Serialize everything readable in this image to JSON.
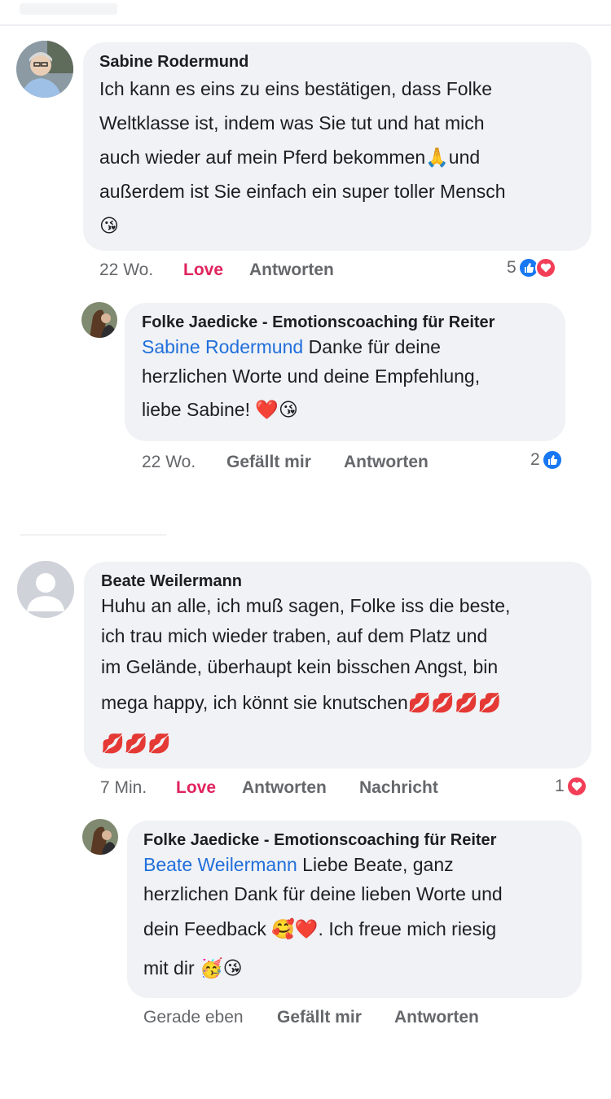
{
  "comments": [
    {
      "author": "Sabine Rodermund",
      "lines": [
        "Ich kann es eins zu eins bestätigen, dass Folke",
        "Weltklasse ist, indem was Sie tut und hat mich",
        "auch wieder auf mein Pferd bekommen🙏und",
        "außerdem ist Sie einfach ein super toller Mensch",
        "😘"
      ],
      "time": "22 Wo.",
      "action1": "Love",
      "reply": "Antworten",
      "reaction_count": "5"
    },
    {
      "author": "Folke Jaedicke - Emotionscoaching für Reiter",
      "mention": "Sabine Rodermund",
      "line1_rest": " Danke für deine",
      "line2": "herzlichen Worte und deine Empfehlung,",
      "line3": "liebe Sabine! ❤️😘",
      "time": "22 Wo.",
      "action1": "Gefällt mir",
      "reply": "Antworten",
      "reaction_count": "2"
    },
    {
      "author": "Beate Weilermann",
      "lines": [
        "Huhu an alle, ich muß sagen, Folke iss die beste,",
        "ich trau mich wieder traben, auf dem Platz und",
        "im Gelände, überhaupt kein bisschen Angst, bin",
        "mega happy, ich könnt sie knutschen💋💋💋💋",
        "💋💋💋"
      ],
      "time": "7 Min.",
      "action1": "Love",
      "reply": "Antworten",
      "message": "Nachricht",
      "reaction_count": "1"
    },
    {
      "author": "Folke Jaedicke - Emotionscoaching für Reiter",
      "mention": "Beate Weilermann",
      "line1_rest": " Liebe Beate, ganz",
      "line2": "herzlichen Dank für deine lieben Worte und",
      "line3": "dein Feedback 🥰❤️. Ich freue mich riesig",
      "line4": "mit dir 🥳😘",
      "time": "Gerade eben",
      "action1": "Gefällt mir",
      "reply": "Antworten"
    }
  ],
  "icons": {
    "like": "thumbs-up-icon",
    "love": "heart-icon"
  },
  "colors": {
    "bubble": "#f0f2f5",
    "mention": "#216fdb",
    "love": "#e0245e",
    "like": "#1877f2",
    "heart": "#f33e58",
    "meta": "#65676b"
  }
}
